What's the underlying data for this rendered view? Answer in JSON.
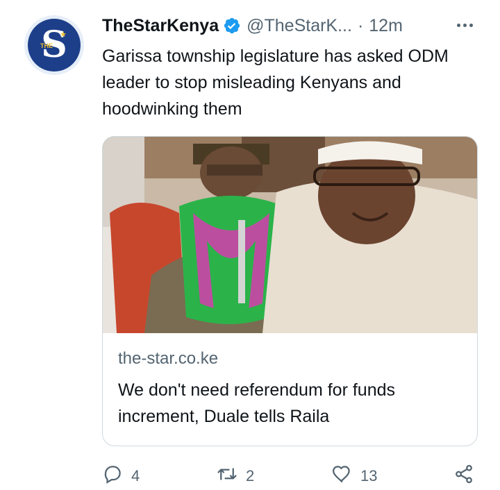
{
  "tweet": {
    "author_name": "TheStarKenya",
    "author_handle": "@TheStarK...",
    "separator": "·",
    "time": "12m",
    "text": "Garissa township legislature has asked ODM leader to stop misleading Kenyans and hoodwinking them",
    "avatar_letter": "S",
    "avatar_small_text": "THE"
  },
  "card": {
    "domain": "the-star.co.ke",
    "title": "We don't need referendum for funds increment, Duale tells Raila"
  },
  "actions": {
    "reply_count": "4",
    "retweet_count": "2",
    "like_count": "13"
  },
  "colors": {
    "verified": "#1d9bf0",
    "secondary_text": "#536471",
    "primary_text": "#0f1419",
    "card_border": "#cfd9de",
    "avatar_bg": "#1d3f8a"
  },
  "icons": [
    "verified-badge-icon",
    "more-icon",
    "reply-icon",
    "retweet-icon",
    "like-icon",
    "share-icon"
  ]
}
